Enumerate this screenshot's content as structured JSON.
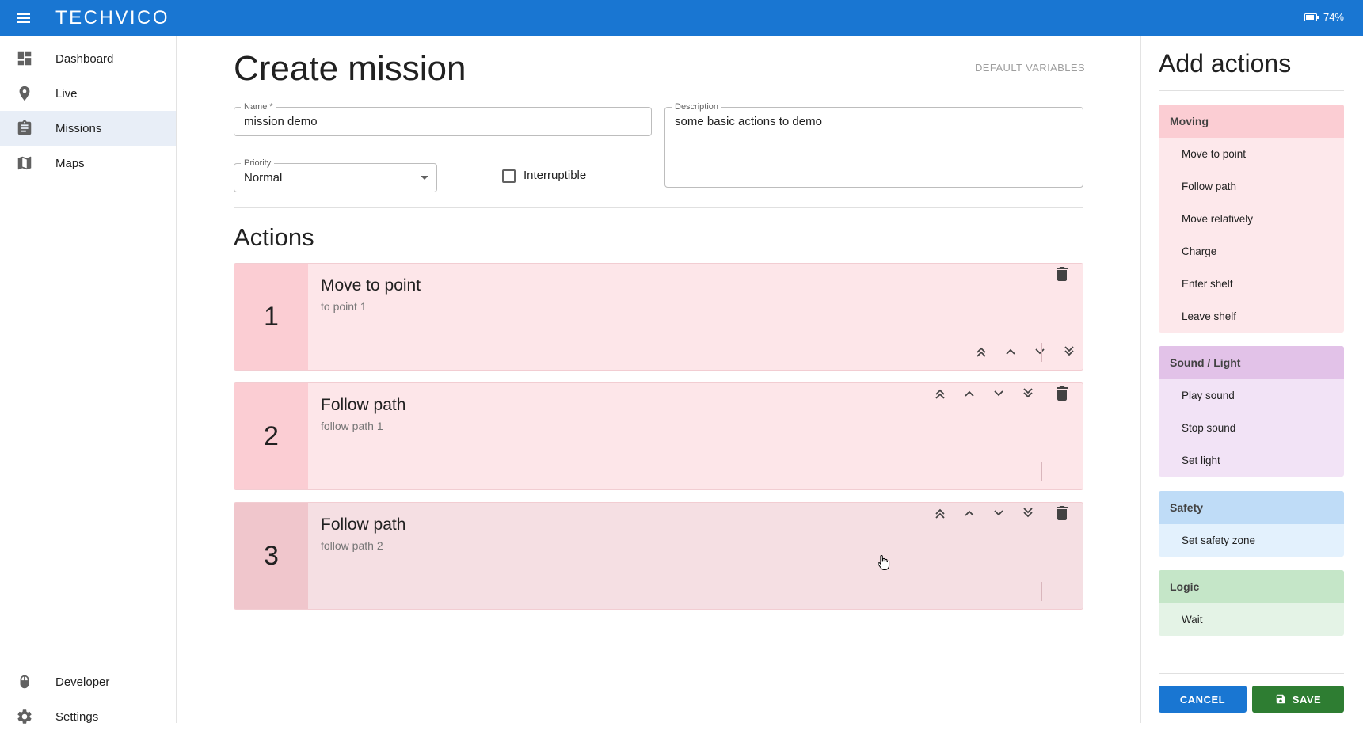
{
  "topbar": {
    "logo": "TECHVICO",
    "battery": "74%"
  },
  "sidebar": {
    "items": [
      {
        "label": "Dashboard",
        "icon": "dashboard-icon"
      },
      {
        "label": "Live",
        "icon": "location-pin-icon"
      },
      {
        "label": "Missions",
        "icon": "clipboard-icon",
        "active": true
      },
      {
        "label": "Maps",
        "icon": "map-icon"
      }
    ],
    "bottom_items": [
      {
        "label": "Developer",
        "icon": "bug-icon"
      },
      {
        "label": "Settings",
        "icon": "gear-icon"
      }
    ]
  },
  "main": {
    "title": "Create mission",
    "default_variables": "DEFAULT VARIABLES",
    "name": {
      "label": "Name *",
      "value": "mission demo"
    },
    "description": {
      "label": "Description",
      "value": "some basic actions to demo"
    },
    "priority": {
      "label": "Priority",
      "value": "Normal"
    },
    "interruptible": {
      "label": "Interruptible",
      "checked": false
    },
    "actions_title": "Actions",
    "actions": [
      {
        "number": "1",
        "title": "Move to point",
        "subtitle": "to point 1"
      },
      {
        "number": "2",
        "title": "Follow path",
        "subtitle": "follow path 1"
      },
      {
        "number": "3",
        "title": "Follow path",
        "subtitle": "follow path 2"
      }
    ]
  },
  "add_actions": {
    "title": "Add actions",
    "groups": [
      {
        "name": "Moving",
        "items": [
          "Move to point",
          "Follow path",
          "Move relatively",
          "Charge",
          "Enter shelf",
          "Leave shelf"
        ]
      },
      {
        "name": "Sound / Light",
        "items": [
          "Play sound",
          "Stop sound",
          "Set light"
        ]
      },
      {
        "name": "Safety",
        "items": [
          "Set safety zone"
        ]
      },
      {
        "name": "Logic",
        "items": [
          "Wait"
        ]
      }
    ],
    "cancel_label": "CANCEL",
    "save_label": "SAVE"
  },
  "colors": {
    "accent": "#1976d2",
    "save": "#2e7d32",
    "moving": "#fbcdd3",
    "sound_light": "#e2c2e8",
    "safety": "#bfdcf7",
    "logic": "#c5e6c8"
  }
}
